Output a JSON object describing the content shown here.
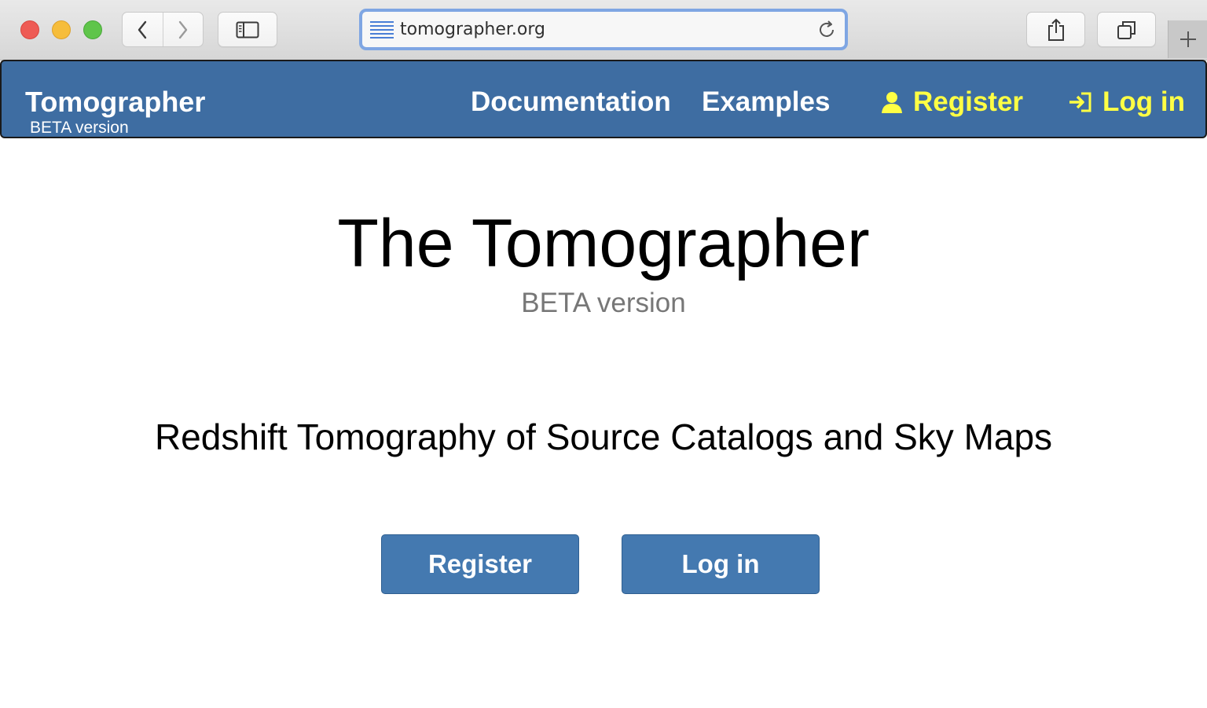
{
  "browser": {
    "url": "tomographer.org",
    "icons": {
      "back": "chevron-left-icon",
      "forward": "chevron-right-icon",
      "sidebar": "sidebar-icon",
      "reader": "reader-lines-icon",
      "reload": "reload-icon",
      "share": "share-icon",
      "tabs": "tabs-overview-icon",
      "new_tab": "plus-icon"
    }
  },
  "navbar": {
    "brand": "Tomographer",
    "brand_sub": "BETA version",
    "links": {
      "documentation": "Documentation",
      "examples": "Examples",
      "register": "Register",
      "login": "Log in"
    },
    "colors": {
      "background": "#3e6da2",
      "link": "#ffffff",
      "auth_link": "#ffff44"
    }
  },
  "main": {
    "title": "The Tomographer",
    "subtitle": "BETA version",
    "tagline": "Redshift Tomography of Source Catalogs and Sky Maps",
    "buttons": {
      "register": "Register",
      "login": "Log in"
    },
    "colors": {
      "button": "#4479b0"
    }
  }
}
